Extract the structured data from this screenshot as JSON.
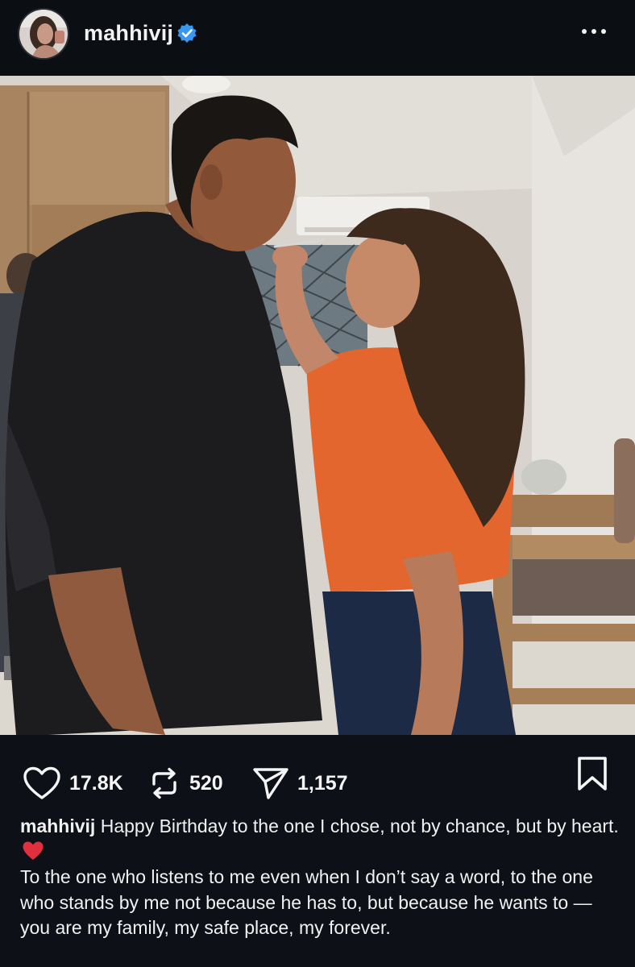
{
  "post": {
    "author": {
      "username": "mahhivij",
      "verified": true,
      "avatar_icon": "profile-photo"
    },
    "more_icon": "more-horizontal-icon",
    "image": {
      "description_icon": "post-photo"
    },
    "actions": {
      "likes": "17.8K",
      "reposts": "520",
      "shares": "1,157",
      "like_icon": "heart-outline-icon",
      "repost_icon": "repost-icon",
      "share_icon": "send-icon",
      "bookmark_icon": "bookmark-icon"
    },
    "caption": {
      "username": "mahhivij",
      "text_line1": "Happy Birthday to the one I chose, not by chance, but by heart.",
      "emoji": "❤️",
      "text_line2": "To the one who listens to me even when I don’t say a word, to the one who stands by me not because he has to, but because he wants to — you are my family, my safe place, my forever."
    }
  },
  "colors": {
    "background": "#0d1016",
    "verified_blue": "#3897f0",
    "text": "#f5f5f5",
    "heart_red": "#e0303c"
  }
}
